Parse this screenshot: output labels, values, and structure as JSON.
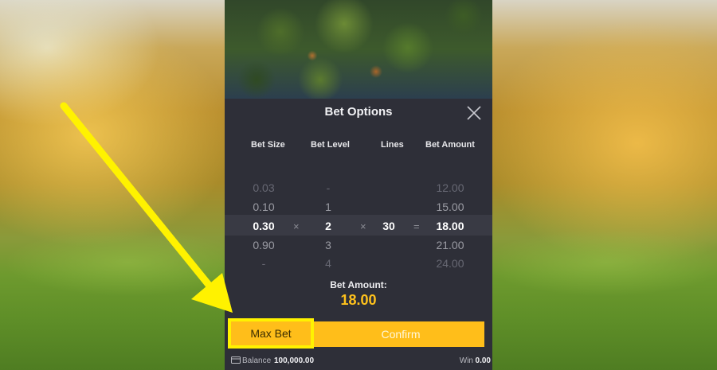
{
  "modal": {
    "title": "Bet Options",
    "headers": {
      "bet_size": "Bet Size",
      "bet_level": "Bet Level",
      "lines": "Lines",
      "bet_amount": "Bet Amount"
    },
    "bet_size_values": [
      "0.03",
      "0.10",
      "0.30",
      "0.90",
      "-"
    ],
    "bet_level_values": [
      "-",
      "1",
      "2",
      "3",
      "4"
    ],
    "lines_value": "30",
    "bet_amount_values": [
      "12.00",
      "15.00",
      "18.00",
      "21.00",
      "24.00"
    ],
    "operators": {
      "times1": "×",
      "times2": "×",
      "equals": "="
    },
    "bet_amount_label": "Bet Amount:",
    "bet_amount_total": "18.00",
    "max_bet_label": "Max Bet",
    "confirm_label": "Confirm"
  },
  "footer": {
    "balance_label": "Balance",
    "balance_value": "100,000.00",
    "win_label": "Win",
    "win_value": "0.00"
  },
  "colors": {
    "accent": "#ffbe1a",
    "highlight_box": "#fff200",
    "arrow": "#fff200",
    "panel": "#2e2f38"
  },
  "icons": [
    "close-icon",
    "wallet-icon",
    "pointer-arrow"
  ]
}
